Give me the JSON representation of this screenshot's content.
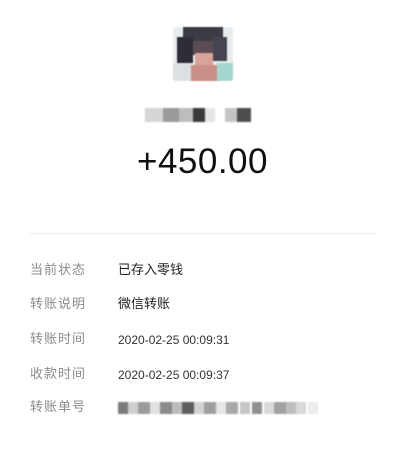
{
  "payment": {
    "amount": "+450.00"
  },
  "details": [
    {
      "label": "当前状态",
      "value": "已存入零钱"
    },
    {
      "label": "转账说明",
      "value": "微信转账"
    },
    {
      "label": "转账时间",
      "value": "2020-02-25 00:09:31"
    },
    {
      "label": "收款时间",
      "value": "2020-02-25 00:09:37"
    },
    {
      "label": "转账单号",
      "value": ""
    }
  ],
  "colors": {
    "amount_text": "#0f0f0f",
    "label_text": "#8c8c8c",
    "value_text": "#222222",
    "divider": "#ececec"
  },
  "icons": {
    "avatar": "pixelated-avatar",
    "name": "pixelated-name",
    "transfer_id": "pixelated-id"
  }
}
